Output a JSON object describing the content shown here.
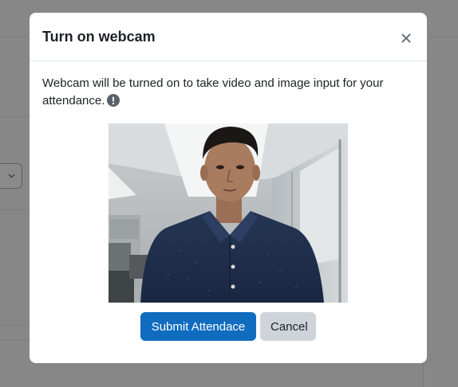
{
  "modal": {
    "title": "Turn on webcam",
    "close_icon": "close-icon",
    "body_text": "Webcam will be turned on to take video and image input for your attendance.",
    "info_icon": "exclamation-circle-icon",
    "webcam_preview": "webcam-video-preview",
    "buttons": {
      "submit_label": "Submit Attendace",
      "cancel_label": "Cancel"
    }
  },
  "background": {
    "select_icon": "chevron-down-icon"
  },
  "colors": {
    "overlay": "#878787",
    "primary": "#0f6cbf",
    "secondary": "#ced4da",
    "text": "#1d2125",
    "border": "#dee2e6"
  }
}
